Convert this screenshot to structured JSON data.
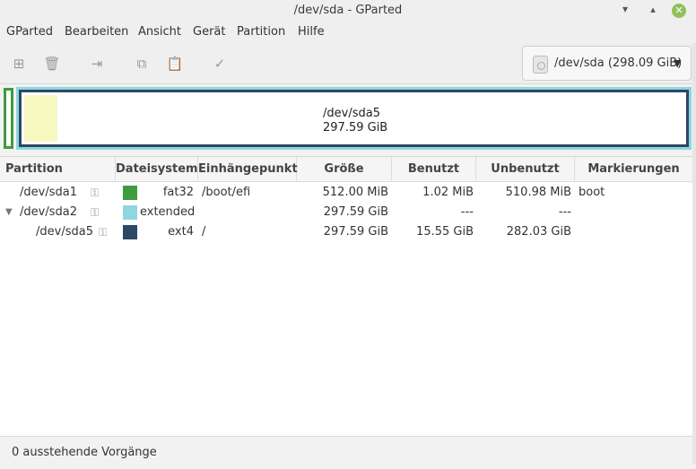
{
  "window": {
    "title": "/dev/sda - GParted"
  },
  "menu": [
    "GParted",
    "Bearbeiten",
    "Ansicht",
    "Gerät",
    "Partition",
    "Hilfe"
  ],
  "toolbar": {
    "icons": [
      "new-partition-icon",
      "delete-icon",
      "resize-icon",
      "copy-icon",
      "paste-icon",
      "apply-icon"
    ],
    "device_label": "/dev/sda (298.09 GiB)"
  },
  "diskmap": {
    "selected_name": "/dev/sda5",
    "selected_size": "297.59 GiB"
  },
  "table": {
    "headers": [
      "Partition",
      "Dateisystem",
      "Einhängepunkt",
      "Größe",
      "Benutzt",
      "Unbenutzt",
      "Markierungen"
    ],
    "rows": [
      {
        "partition": "/dev/sda1",
        "filesystem": "fat32",
        "mount": "/boot/efi",
        "size": "512.00 MiB",
        "used": "1.02 MiB",
        "unused": "510.98 MiB",
        "flags": "boot",
        "color": "#3e9b3e"
      },
      {
        "partition": "/dev/sda2",
        "filesystem": "extended",
        "mount": "",
        "size": "297.59 GiB",
        "used": "---",
        "unused": "---",
        "flags": "",
        "color": "#8fd6de"
      },
      {
        "partition": "/dev/sda5",
        "filesystem": "ext4",
        "mount": "/",
        "size": "297.59 GiB",
        "used": "15.55 GiB",
        "unused": "282.03 GiB",
        "flags": "",
        "color": "#2b4865"
      }
    ]
  },
  "status": {
    "text": "0 ausstehende Vorgänge"
  },
  "colors": {
    "fat32": "#3e9b3e",
    "extended": "#8fd6de",
    "ext4": "#2b4865",
    "used": "#f7f7c0"
  }
}
